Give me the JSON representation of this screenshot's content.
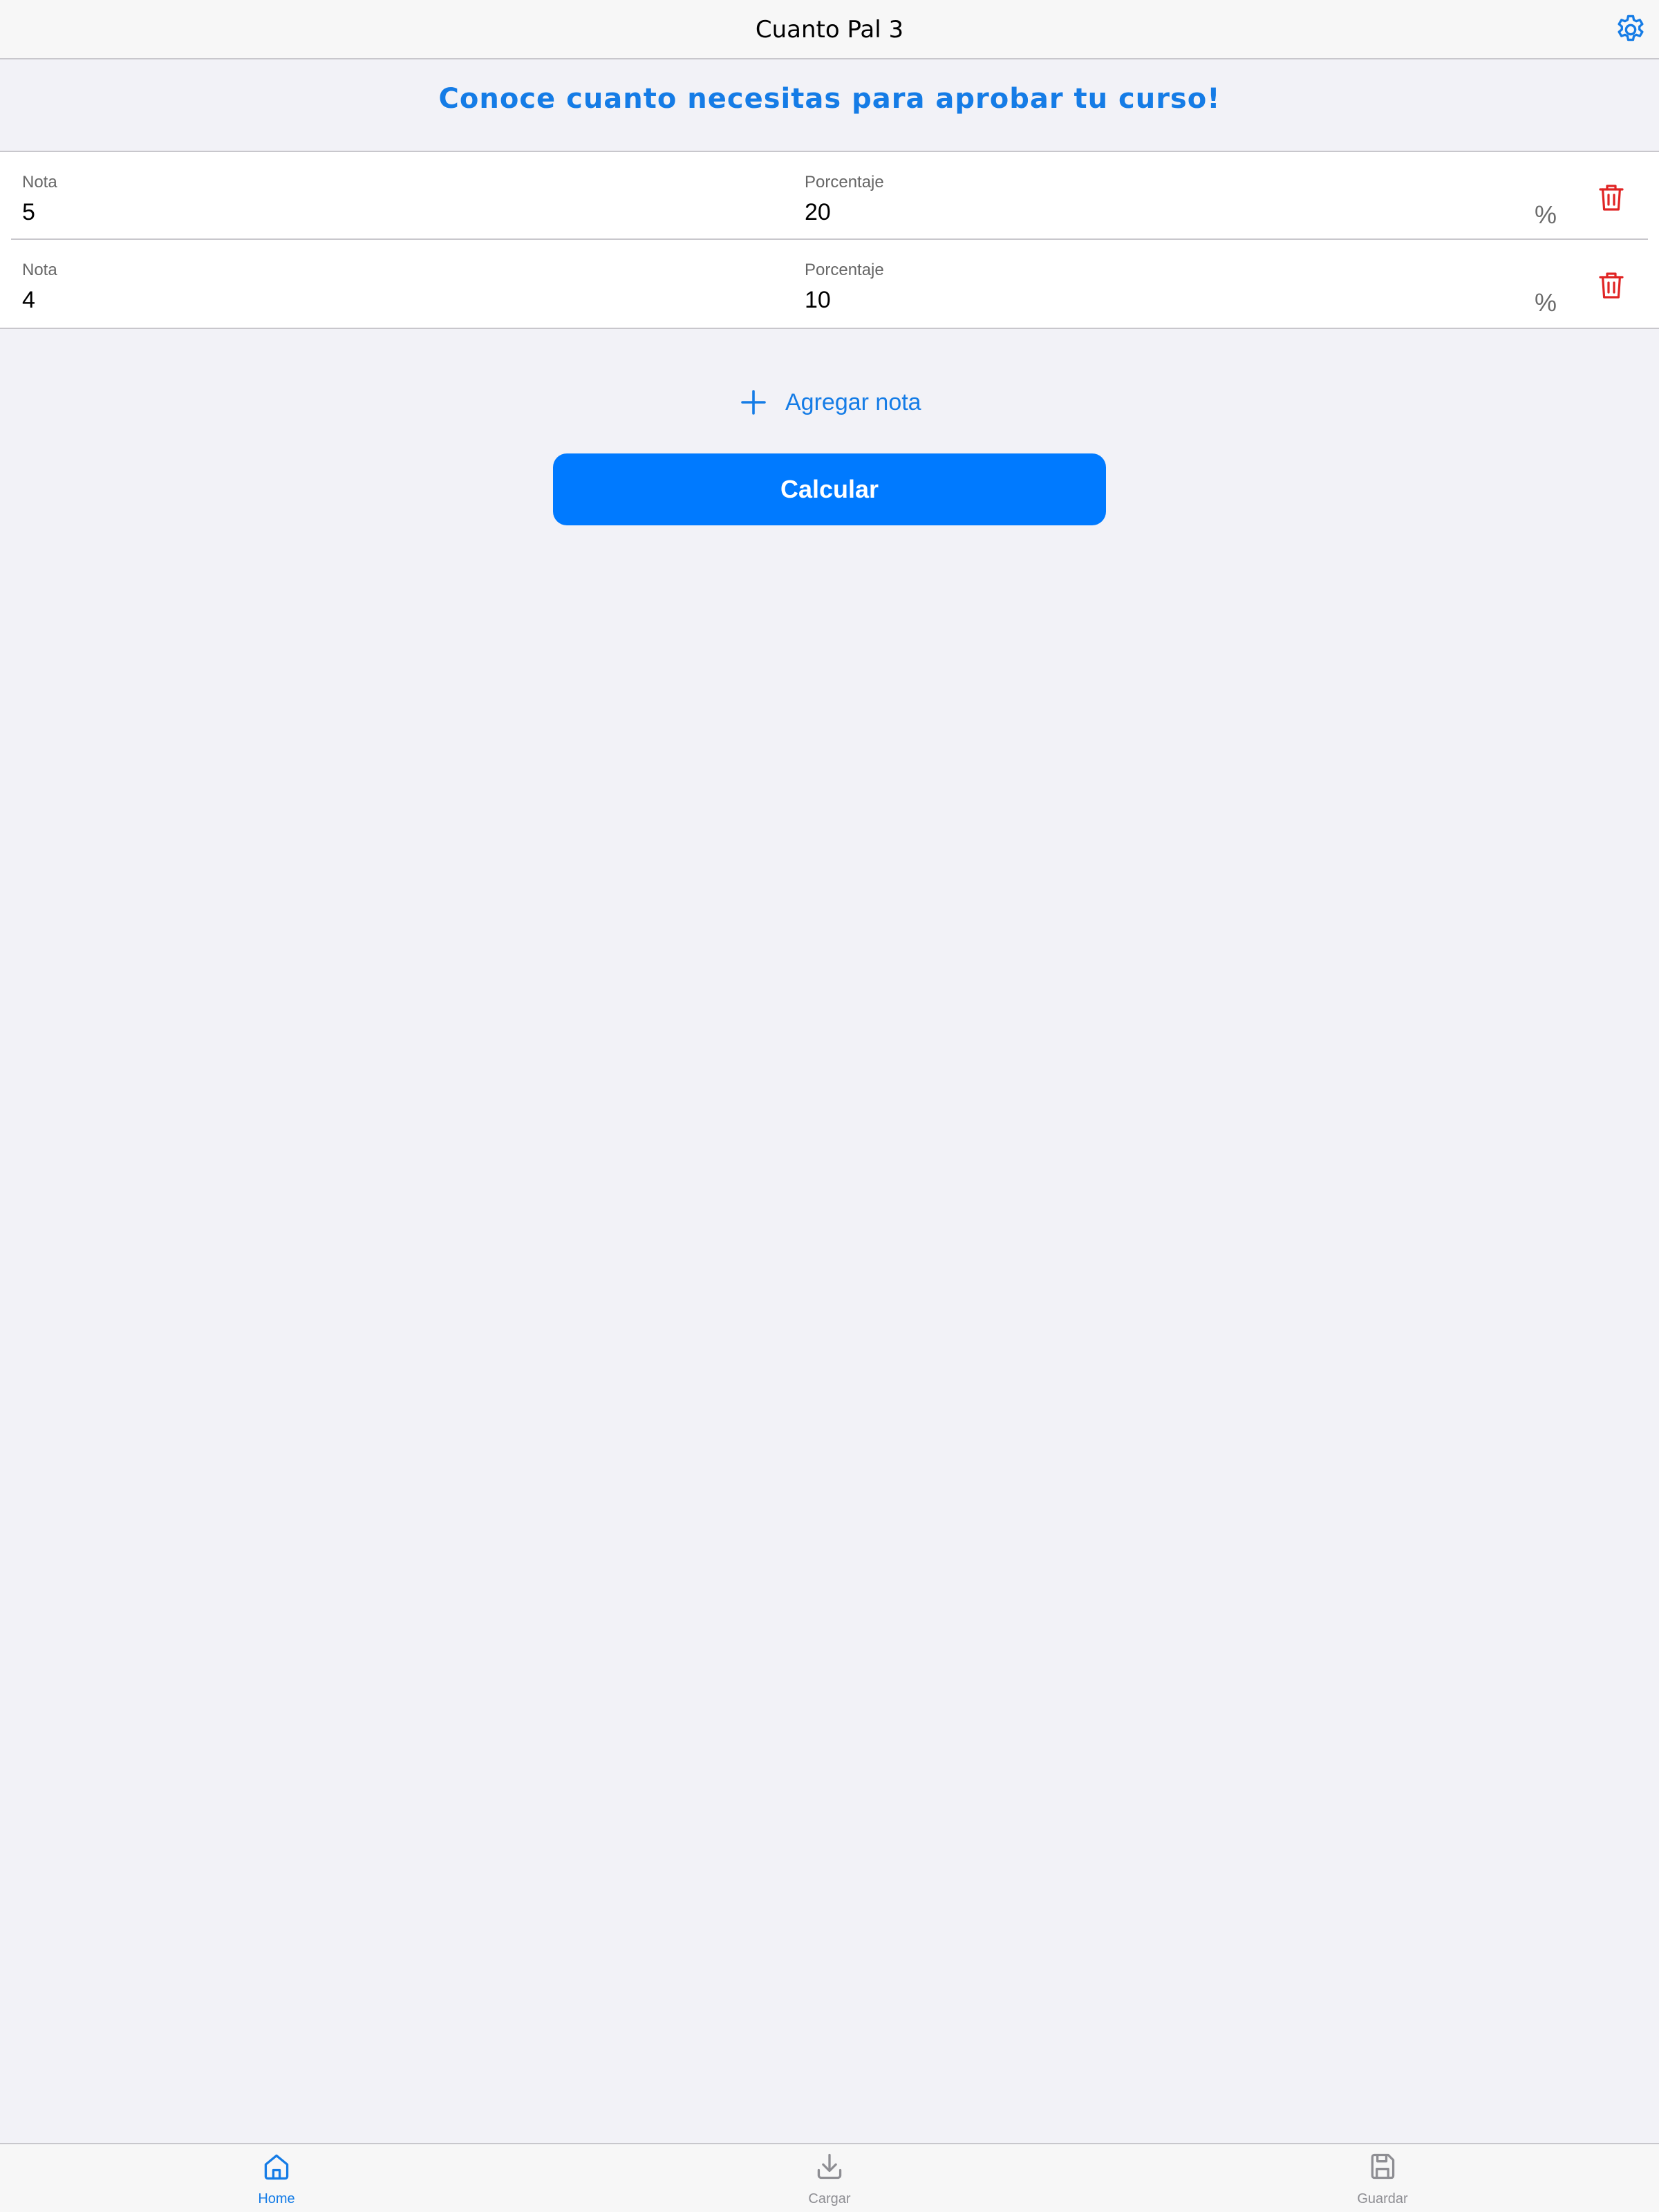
{
  "header": {
    "title": "Cuanto Pal 3",
    "settings_icon": "gear-icon"
  },
  "subtitle": "Conoce cuanto necesitas para aprobar tu curso!",
  "grades": [
    {
      "nota_label": "Nota",
      "nota_value": "5",
      "porcentaje_label": "Porcentaje",
      "porcentaje_value": "20",
      "suffix": "%"
    },
    {
      "nota_label": "Nota",
      "nota_value": "4",
      "porcentaje_label": "Porcentaje",
      "porcentaje_value": "10",
      "suffix": "%"
    }
  ],
  "add_button": {
    "label": "Agregar nota",
    "icon": "plus-icon"
  },
  "calc_button": {
    "label": "Calcular"
  },
  "tabbar": {
    "tabs": [
      {
        "label": "Home",
        "icon": "home-icon",
        "active": true
      },
      {
        "label": "Cargar",
        "icon": "download-icon",
        "active": false
      },
      {
        "label": "Guardar",
        "icon": "save-icon",
        "active": false
      }
    ]
  },
  "colors": {
    "accent": "#157ce6",
    "button": "#007aff",
    "delete": "#e02424",
    "inactive": "#8e8e93",
    "background": "#f2f2f7"
  }
}
